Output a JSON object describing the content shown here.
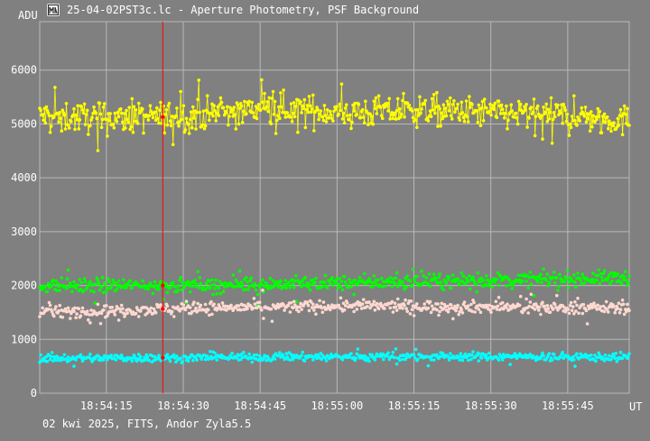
{
  "window": {
    "title": "25-04-02PST3c.lc - Aperture Photometry, PSF Background",
    "icon": "chart-icon"
  },
  "axes": {
    "y_unit": "ADU",
    "x_unit": "UT"
  },
  "footer": "02 kwi 2025, FITS, Andor Zyla5.5",
  "colors": {
    "background": "#808080",
    "grid": "#b8b8b8",
    "cursor": "#ff0000",
    "series": [
      "#ffff00",
      "#00ff00",
      "#ffd8d0",
      "#00ffff"
    ]
  },
  "chart_data": {
    "type": "scatter",
    "title": "",
    "ylabel": "ADU",
    "xlabel": "UT",
    "ylim": [
      0,
      6900
    ],
    "y_ticks": [
      0,
      1000,
      2000,
      3000,
      4000,
      5000,
      6000
    ],
    "y_tick_labels": [
      "0",
      "1000",
      "2000",
      "3000",
      "4000",
      "5000",
      "6000"
    ],
    "x_tick_labels": [
      "18:54:15",
      "18:54:30",
      "18:54:45",
      "18:55:00",
      "18:55:15",
      "18:55:30",
      "18:55:45"
    ],
    "x_range": [
      "18:54:02",
      "18:55:57"
    ],
    "grid": true,
    "cursor_time": "18:54:26",
    "series": [
      {
        "color": "#ffff00",
        "connected": true,
        "mean": [
          [
            0,
            5150
          ],
          [
            15,
            5100
          ],
          [
            30,
            5150
          ],
          [
            45,
            5300
          ],
          [
            60,
            5200
          ],
          [
            75,
            5250
          ],
          [
            90,
            5200
          ],
          [
            105,
            5150
          ],
          [
            115,
            5050
          ]
        ],
        "scatter": 260
      },
      {
        "color": "#00ff00",
        "connected": false,
        "mean": [
          [
            0,
            2000
          ],
          [
            30,
            2000
          ],
          [
            60,
            2050
          ],
          [
            90,
            2100
          ],
          [
            115,
            2150
          ]
        ],
        "scatter": 120
      },
      {
        "color": "#ffd8d0",
        "connected": false,
        "mean": [
          [
            0,
            1500
          ],
          [
            30,
            1580
          ],
          [
            60,
            1620
          ],
          [
            90,
            1600
          ],
          [
            115,
            1580
          ]
        ],
        "scatter": 100
      },
      {
        "color": "#00ffff",
        "connected": false,
        "mean": [
          [
            0,
            650
          ],
          [
            30,
            660
          ],
          [
            60,
            680
          ],
          [
            90,
            680
          ],
          [
            115,
            670
          ]
        ],
        "scatter": 70
      }
    ]
  }
}
